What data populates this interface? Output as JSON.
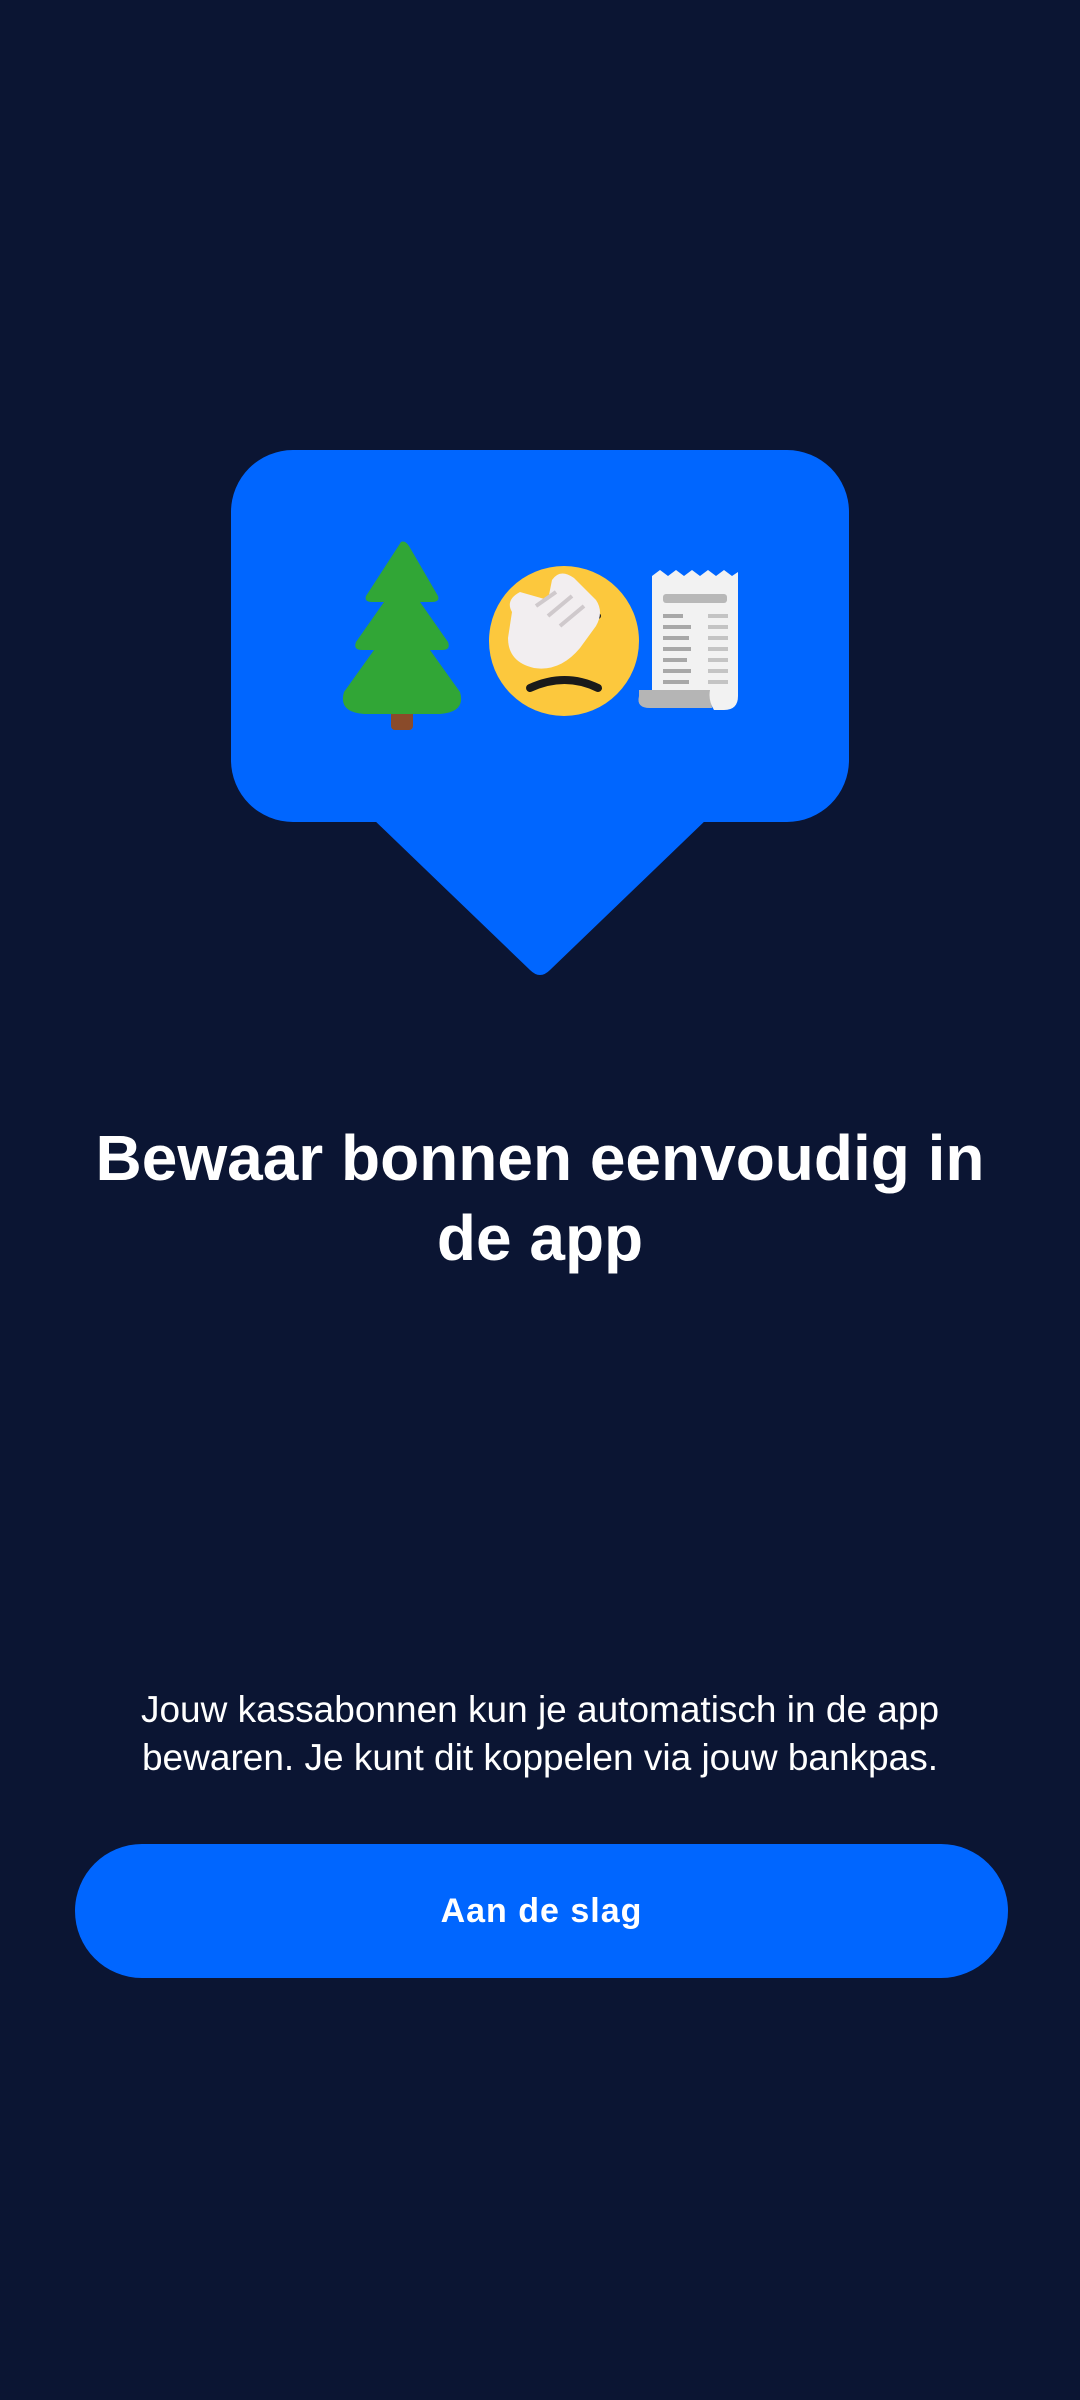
{
  "onboarding": {
    "title": "Bewaar bonnen eenvoudig in de app",
    "description": "Jouw kassabonnen kun je automatisch in de app bewaren. Je kunt dit koppelen via jouw bankpas.",
    "cta_label": "Aan de slag"
  },
  "illustration": {
    "icons": [
      "evergreen-tree-icon",
      "face-palm-icon",
      "receipt-icon"
    ]
  },
  "colors": {
    "background": "#0b1533",
    "accent": "#0066ff",
    "text": "#ffffff"
  }
}
